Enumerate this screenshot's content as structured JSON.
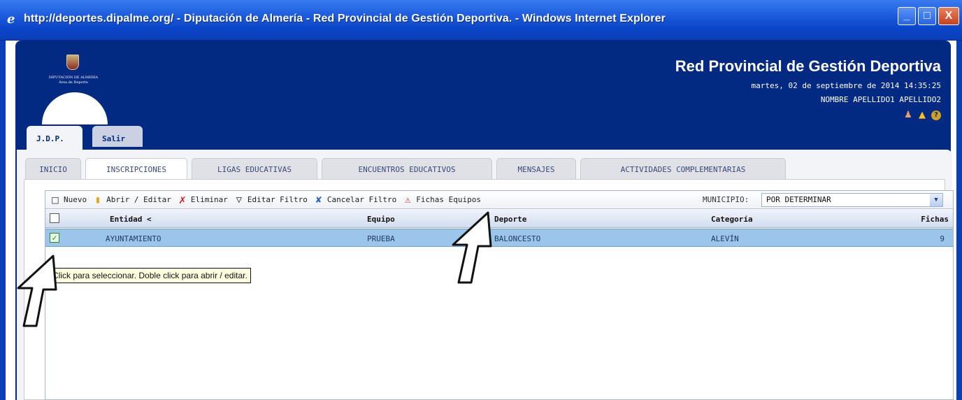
{
  "window": {
    "title": "http://deportes.dipalme.org/ - Diputación de Almería - Red Provincial de Gestión Deportiva. - Windows Internet Explorer",
    "controls": {
      "minimize": "_",
      "maximize": "□",
      "close": "X"
    }
  },
  "header": {
    "logo_line1": "DIPUTACIÓN DE ALMERÍA",
    "logo_line2": "Área de Deporte",
    "title": "Red Provincial de Gestión Deportiva",
    "datetime": "martes, 02 de septiembre de 2014 14:35:25",
    "user": "NOMBRE APELLIDO1 APELLIDO2",
    "icons": [
      "user-icon",
      "warning-icon",
      "help-icon"
    ]
  },
  "top_tabs": [
    {
      "label": "J.D.P.",
      "active": true
    },
    {
      "label": "Salir",
      "active": false
    }
  ],
  "sub_tabs": [
    {
      "label": "INICIO",
      "active": false
    },
    {
      "label": "INSCRIPCIONES",
      "active": true
    },
    {
      "label": "LIGAS EDUCATIVAS",
      "active": false
    },
    {
      "label": "ENCUENTROS EDUCATIVOS",
      "active": false
    },
    {
      "label": "MENSAJES",
      "active": false
    },
    {
      "label": "ACTIVIDADES COMPLEMENTARIAS",
      "active": false
    }
  ],
  "toolbar": {
    "nuevo": "Nuevo",
    "abrir_editar": "Abrir / Editar",
    "eliminar": "Eliminar",
    "editar_filtro": "Editar Filtro",
    "cancelar_filtro": "Cancelar Filtro",
    "fichas_equipos": "Fichas Equipos",
    "municipio_label": "MUNICIPIO:",
    "municipio_value": "POR DETERMINAR"
  },
  "table": {
    "columns": [
      "Entidad <",
      "Equipo",
      "Deporte",
      "Categoría",
      "Fichas"
    ],
    "rows": [
      {
        "checked": true,
        "entidad": "AYUNTAMIENTO",
        "equipo": "PRUEBA",
        "deporte": "BALONCESTO",
        "categoria": "ALEVÍN",
        "fichas": "9"
      }
    ]
  },
  "tooltip": "Click para seleccionar. Doble click para abrir / editar.",
  "colors": {
    "titlebar": "#0a46c9",
    "app_background": "#022a82",
    "selected_row": "#9cc5ec"
  }
}
